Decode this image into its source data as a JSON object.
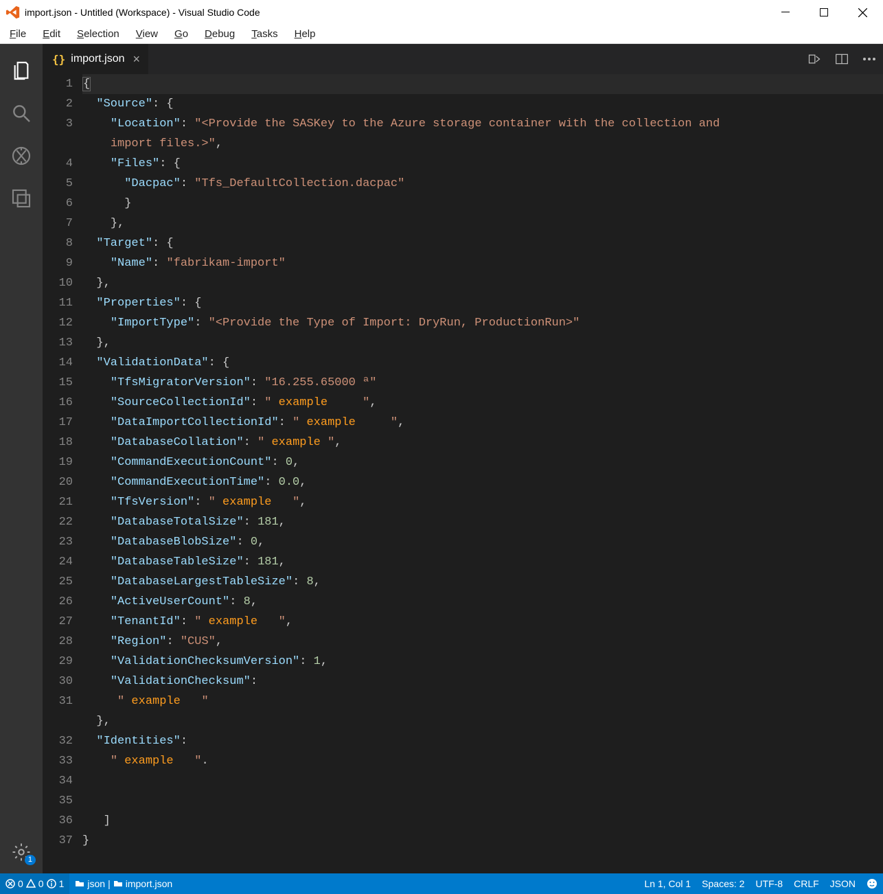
{
  "window_title": "import.json - Untitled (Workspace) - Visual Studio Code",
  "menu_file_u": "F",
  "menu_file_r": "ile",
  "menu_edit_u": "E",
  "menu_edit_r": "dit",
  "menu_selection_u": "S",
  "menu_selection_r": "election",
  "menu_view_u": "V",
  "menu_view_r": "iew",
  "menu_go_u": "G",
  "menu_go_r": "o",
  "menu_debug_u": "D",
  "menu_debug_r": "ebug",
  "menu_tasks_u": "T",
  "menu_tasks_r": "asks",
  "menu_help_u": "H",
  "menu_help_r": "elp",
  "tab_name": "import.json",
  "tab_brace_icon": "{}",
  "gear_badge": "1",
  "status_errors": "0",
  "status_warnings": "0",
  "status_info": "1",
  "status_folder1": "json",
  "status_folder_sep": " | ",
  "status_folder2": "import.json",
  "status_ln_col": "Ln 1, Col 1",
  "status_spaces": "Spaces: 2",
  "status_encoding": "UTF-8",
  "status_eol": "CRLF",
  "status_lang": "JSON",
  "line_numbers": [
    "1",
    "2",
    "3",
    "",
    "4",
    "5",
    "6",
    "7",
    "8",
    "9",
    "10",
    "11",
    "12",
    "13",
    "14",
    "15",
    "16",
    "17",
    "18",
    "19",
    "20",
    "21",
    "22",
    "23",
    "24",
    "25",
    "26",
    "27",
    "28",
    "29",
    "30",
    "31",
    "",
    "32",
    "33",
    "34",
    "35",
    "36",
    "37"
  ],
  "c": {
    "open_bracket": "{",
    "source_open": "\"Source\"",
    "colon_brace": ": {",
    "location_k": "\"Location\"",
    "colon_q": ": ",
    "location_v": "\"<Provide the SASKey to the Azure storage container with the collection and",
    "location_v2": "import files.>\"",
    "comma": ",",
    "files_k": "\"Files\"",
    "dacpac_k": "\"Dacpac\"",
    "dacpac_v": "\"Tfs_DefaultCollection.dacpac\"",
    "close_brace": "}",
    "close_brace_c": "},",
    "target_k": "\"Target\"",
    "name_k": "\"Name\"",
    "name_v": "\"fabrikam-import\"",
    "properties_k": "\"Properties\"",
    "importtype_k": "\"ImportType\"",
    "importtype_v": "\"<Provide the Type of Import: DryRun, ProductionRun>\"",
    "vd_k": "\"ValidationData\"",
    "tfsm_k": "\"TfsMigratorVersion\"",
    "tfsm_v": "\"16.255.65000 ª\"",
    "scid_k": "\"SourceCollectionId\"",
    "ex_q1": "\" ",
    "ex_text": "example",
    "ex_q2": "     \"",
    "dicid_k": "\"DataImportCollectionId\"",
    "dbcoll_k": "\"DatabaseCollation\"",
    "dbcoll_tail": " \"",
    "cec_k": "\"CommandExecutionCount\"",
    "v0": "0",
    "cet_k": "\"CommandExecutionTime\"",
    "v0f": "0.0",
    "tfsv_k": "\"TfsVersion\"",
    "dbts_k": "\"DatabaseTotalSize\"",
    "v181": "181",
    "dbbs_k": "\"DatabaseBlobSize\"",
    "dbtab_k": "\"DatabaseTableSize\"",
    "dblts_k": "\"DatabaseLargestTableSize\"",
    "v8": "8",
    "auc_k": "\"ActiveUserCount\"",
    "tid_k": "\"TenantId\"",
    "region_k": "\"Region\"",
    "region_v": "\"CUS\"",
    "vcv_k": "\"ValidationChecksumVersion\"",
    "v1": "1",
    "vc_k": "\"ValidationChecksum\"",
    "vc_q": "\"",
    "ident_k": "\"Identities\"",
    "ident_dot": ".",
    "close_sq": "]"
  }
}
